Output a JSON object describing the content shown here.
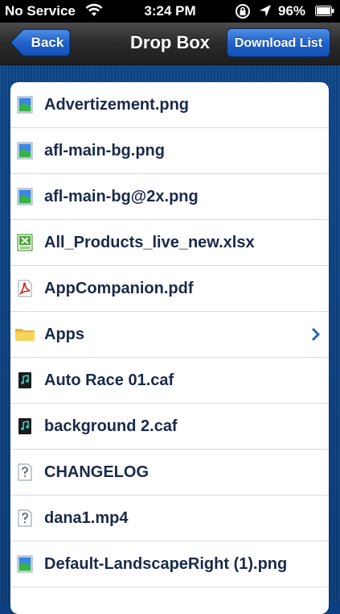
{
  "status_bar": {
    "carrier": "No Service",
    "time": "3:24 PM",
    "battery": "96%"
  },
  "nav": {
    "back_label": "Back",
    "title": "Drop Box",
    "download_label": "Download List"
  },
  "files": [
    {
      "name": "Advertizement.png",
      "icon": "image-file-icon"
    },
    {
      "name": "afl-main-bg.png",
      "icon": "image-file-icon"
    },
    {
      "name": "afl-main-bg@2x.png",
      "icon": "image-file-icon"
    },
    {
      "name": "All_Products_live_new.xlsx",
      "icon": "spreadsheet-file-icon"
    },
    {
      "name": "AppCompanion.pdf",
      "icon": "pdf-file-icon"
    },
    {
      "name": "Apps",
      "icon": "folder-icon"
    },
    {
      "name": "Auto Race 01.caf",
      "icon": "audio-file-icon"
    },
    {
      "name": "background 2.caf",
      "icon": "audio-file-icon"
    },
    {
      "name": "CHANGELOG",
      "icon": "unknown-file-icon"
    },
    {
      "name": "dana1.mp4",
      "icon": "unknown-file-icon"
    },
    {
      "name": "Default-LandscapeRight (1).png",
      "icon": "image-file-icon"
    }
  ],
  "colors": {
    "background": "#0b3f82",
    "accent": "#2062c9",
    "text": "#1a2a4a"
  }
}
